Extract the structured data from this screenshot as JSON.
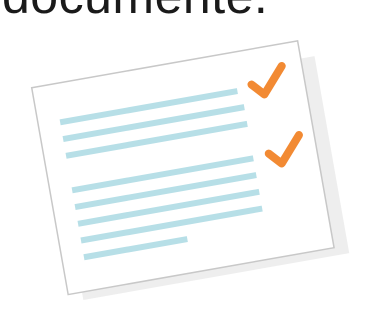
{
  "heading": {
    "text": "documente."
  },
  "illustration": {
    "paper_color": "#ffffff",
    "paper_border_color": "#c8c8c8",
    "shadow_color": "#e2e2e2",
    "line_color": "#b7dfe7",
    "check_color": "#f28a33",
    "checkmark_icon": "checkmark-icon",
    "document_icon": "document-icon"
  }
}
